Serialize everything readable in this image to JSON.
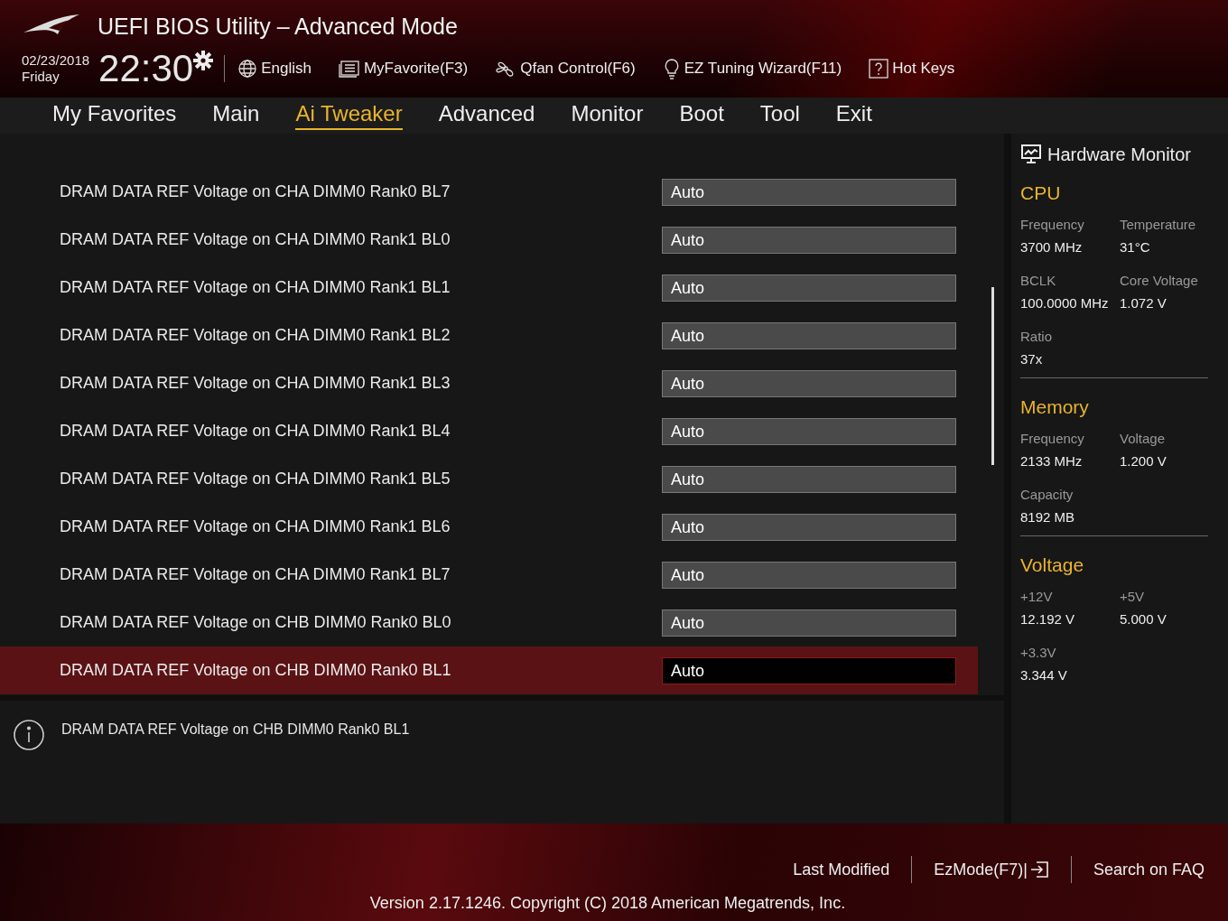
{
  "window": {
    "title": "UEFI BIOS Utility – Advanced Mode"
  },
  "header": {
    "date": "02/23/2018",
    "day": "Friday",
    "time": "22:30",
    "tools": [
      {
        "kind": "globe",
        "label": "English"
      },
      {
        "kind": "list",
        "label": "MyFavorite(F3)"
      },
      {
        "kind": "fan",
        "label": "Qfan Control(F6)"
      },
      {
        "kind": "bulb",
        "label": "EZ Tuning Wizard(F11)"
      },
      {
        "kind": "help",
        "label": "Hot Keys"
      }
    ]
  },
  "tabs": [
    {
      "label": "My Favorites",
      "selected": false
    },
    {
      "label": "Main",
      "selected": false
    },
    {
      "label": "Ai Tweaker",
      "selected": true
    },
    {
      "label": "Advanced",
      "selected": false
    },
    {
      "label": "Monitor",
      "selected": false
    },
    {
      "label": "Boot",
      "selected": false
    },
    {
      "label": "Tool",
      "selected": false
    },
    {
      "label": "Exit",
      "selected": false
    }
  ],
  "settings": [
    {
      "label": "DRAM DATA REF Voltage on CHA DIMM0 Rank0 BL7",
      "value": "Auto",
      "selected": false
    },
    {
      "label": "DRAM DATA REF Voltage on CHA DIMM0 Rank1 BL0",
      "value": "Auto",
      "selected": false
    },
    {
      "label": "DRAM DATA REF Voltage on CHA DIMM0 Rank1 BL1",
      "value": "Auto",
      "selected": false
    },
    {
      "label": "DRAM DATA REF Voltage on CHA DIMM0 Rank1 BL2",
      "value": "Auto",
      "selected": false
    },
    {
      "label": "DRAM DATA REF Voltage on CHA DIMM0 Rank1 BL3",
      "value": "Auto",
      "selected": false
    },
    {
      "label": "DRAM DATA REF Voltage on CHA DIMM0 Rank1 BL4",
      "value": "Auto",
      "selected": false
    },
    {
      "label": "DRAM DATA REF Voltage on CHA DIMM0 Rank1 BL5",
      "value": "Auto",
      "selected": false
    },
    {
      "label": "DRAM DATA REF Voltage on CHA DIMM0 Rank1 BL6",
      "value": "Auto",
      "selected": false
    },
    {
      "label": "DRAM DATA REF Voltage on CHA DIMM0 Rank1 BL7",
      "value": "Auto",
      "selected": false
    },
    {
      "label": "DRAM DATA REF Voltage on CHB DIMM0 Rank0 BL0",
      "value": "Auto",
      "selected": false
    },
    {
      "label": "DRAM DATA REF Voltage on CHB DIMM0 Rank0 BL1",
      "value": "Auto",
      "selected": true
    }
  ],
  "help": {
    "text": "DRAM DATA REF Voltage on CHB DIMM0 Rank0 BL1"
  },
  "hardware_monitor": {
    "title": "Hardware Monitor",
    "sections": [
      {
        "title": "CPU",
        "items": [
          {
            "label": "Frequency",
            "value": "3700 MHz"
          },
          {
            "label": "Temperature",
            "value": "31°C"
          },
          {
            "label": "BCLK",
            "value": "100.0000 MHz"
          },
          {
            "label": "Core Voltage",
            "value": "1.072 V"
          },
          {
            "label": "Ratio",
            "value": "37x"
          }
        ]
      },
      {
        "title": "Memory",
        "items": [
          {
            "label": "Frequency",
            "value": "2133 MHz"
          },
          {
            "label": "Voltage",
            "value": "1.200 V"
          },
          {
            "label": "Capacity",
            "value": "8192 MB"
          }
        ]
      },
      {
        "title": "Voltage",
        "items": [
          {
            "label": "+12V",
            "value": "12.192 V"
          },
          {
            "label": "+5V",
            "value": "5.000 V"
          },
          {
            "label": "+3.3V",
            "value": "3.344 V"
          }
        ]
      }
    ]
  },
  "footer": {
    "links": [
      {
        "label": "Last Modified",
        "kind": "text"
      },
      {
        "label": "EzMode(F7)|",
        "kind": "exit"
      },
      {
        "label": "Search on FAQ",
        "kind": "text"
      }
    ],
    "version": "Version 2.17.1246. Copyright (C) 2018 American Megatrends, Inc."
  }
}
